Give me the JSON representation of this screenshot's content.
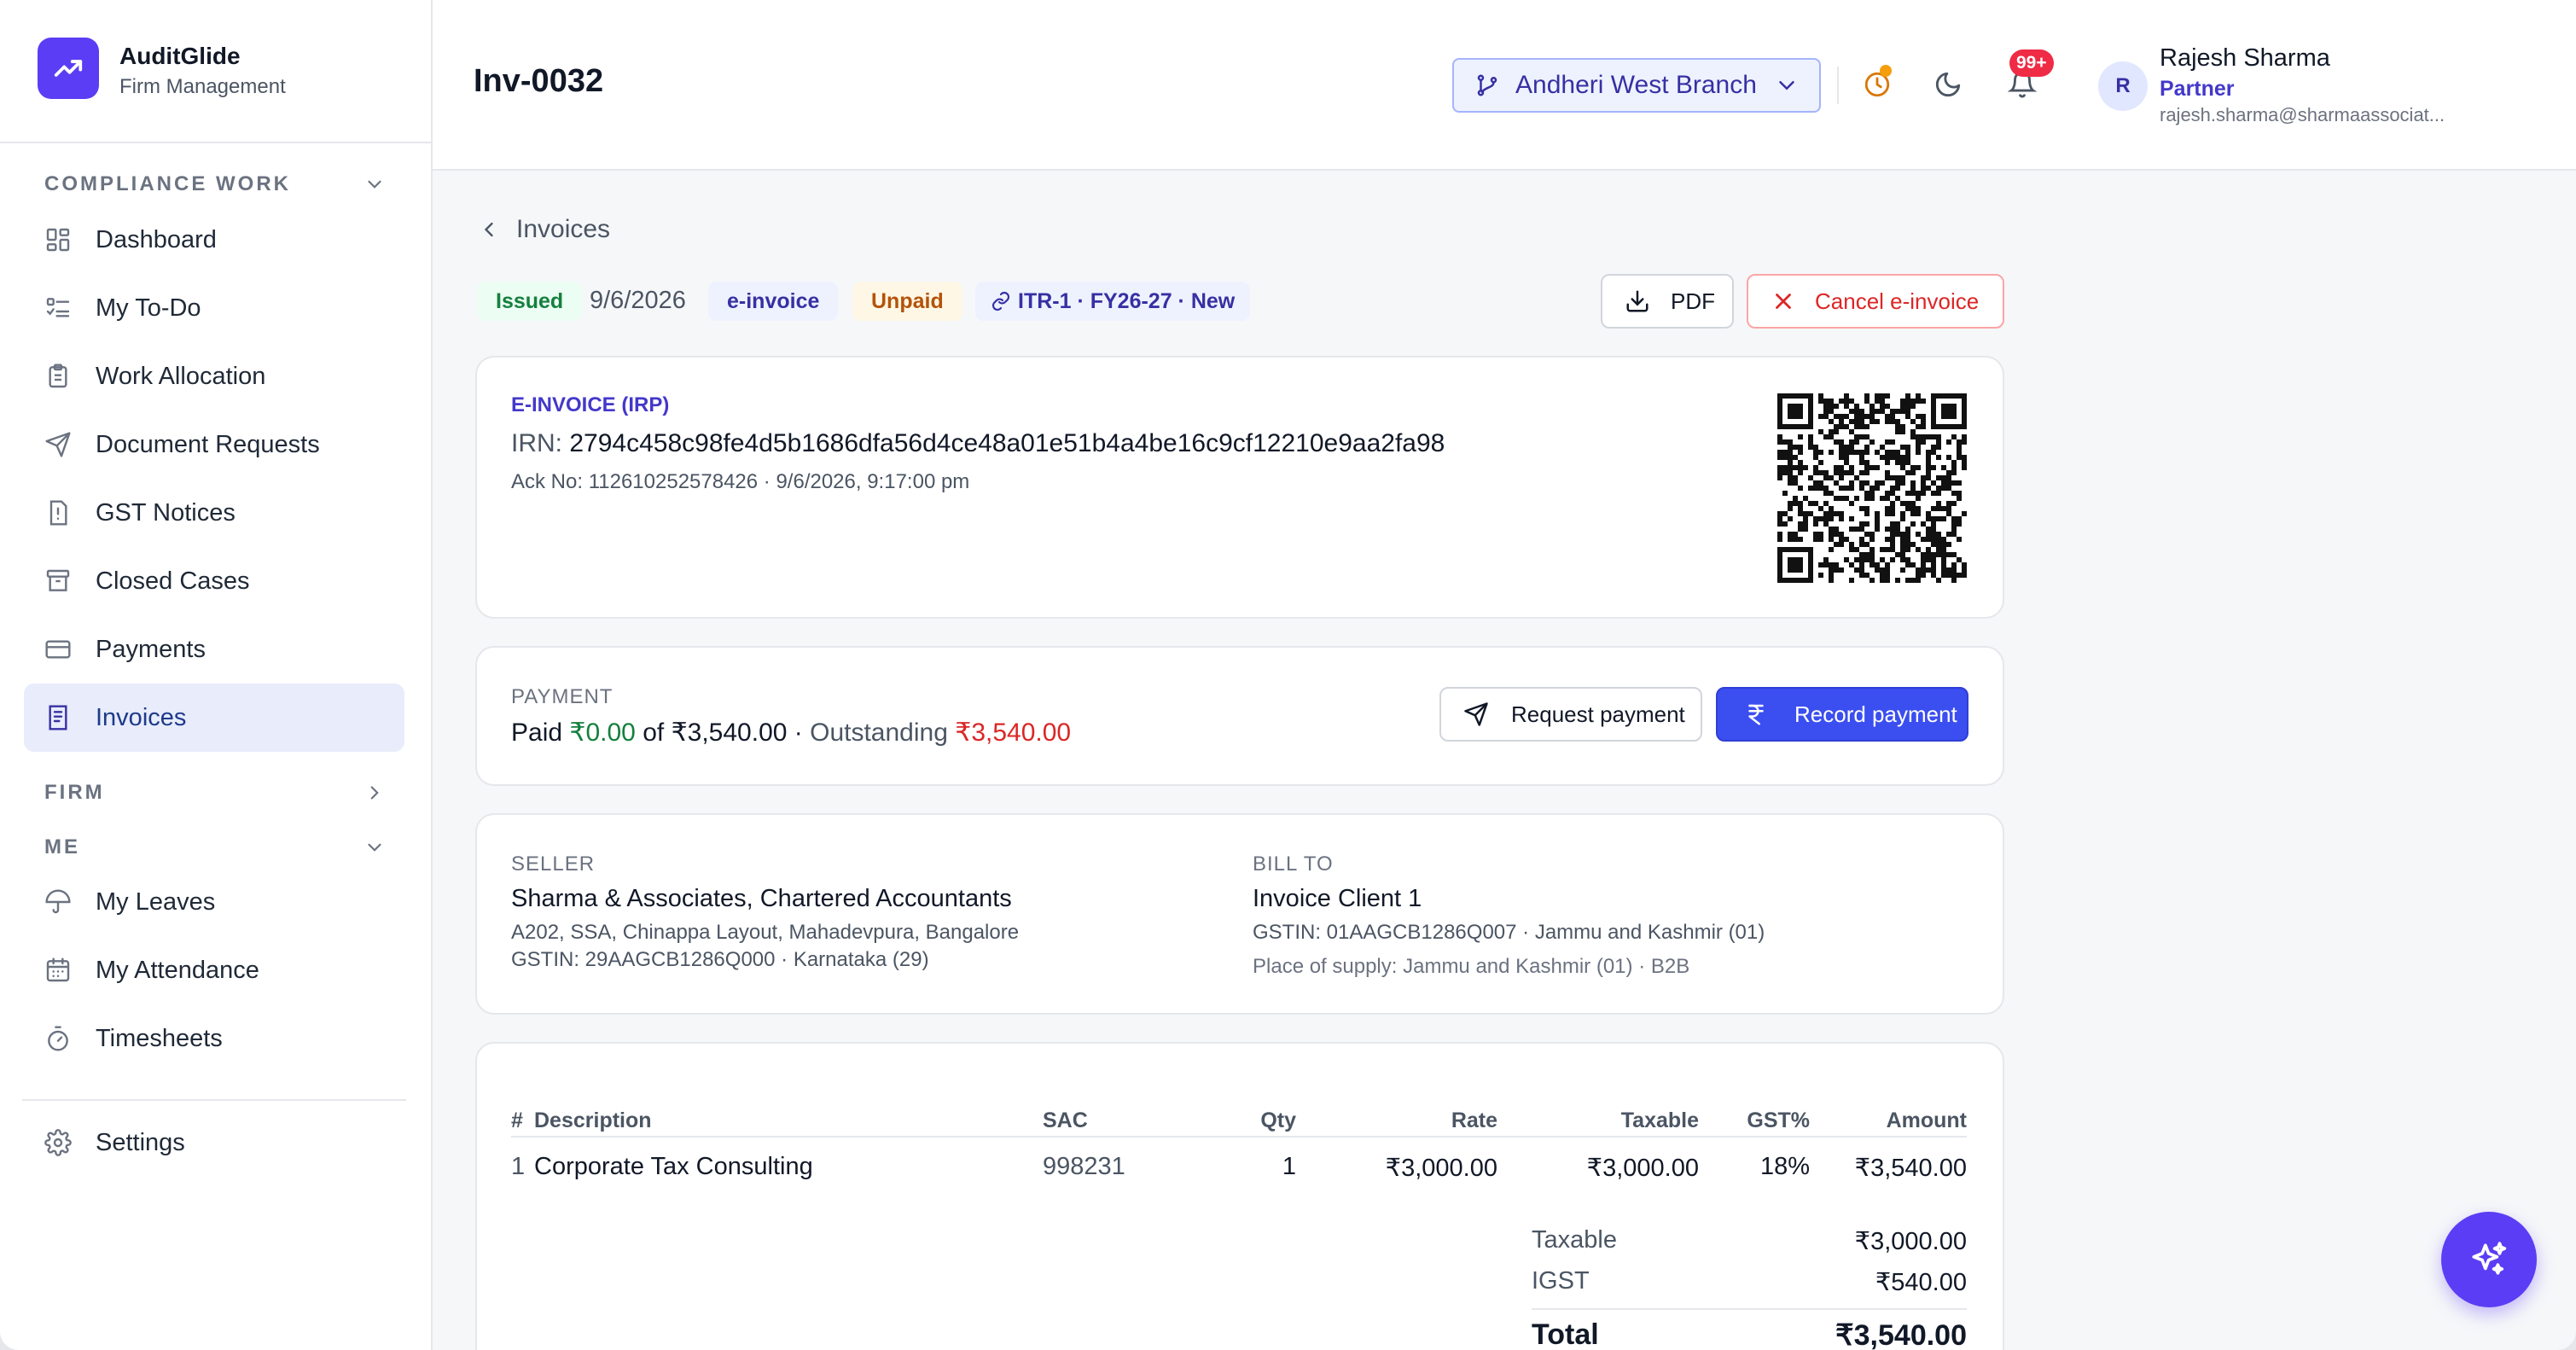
{
  "brand": {
    "name": "AuditGlide",
    "subtitle": "Firm Management"
  },
  "sidebar": {
    "sections": [
      {
        "label": "COMPLIANCE WORK",
        "expanded": true
      },
      {
        "label": "FIRM",
        "expanded": false
      },
      {
        "label": "ME",
        "expanded": true
      }
    ],
    "items": [
      {
        "label": "Dashboard",
        "icon": "dashboard-icon"
      },
      {
        "label": "My To-Do",
        "icon": "todo-list-icon"
      },
      {
        "label": "Work Allocation",
        "icon": "clipboard-icon"
      },
      {
        "label": "Document Requests",
        "icon": "send-icon"
      },
      {
        "label": "GST Notices",
        "icon": "notice-icon"
      },
      {
        "label": "Closed Cases",
        "icon": "archive-icon"
      },
      {
        "label": "Payments",
        "icon": "card-icon"
      },
      {
        "label": "Invoices",
        "icon": "invoice-icon",
        "active": true
      },
      {
        "label": "My Leaves",
        "icon": "umbrella-icon"
      },
      {
        "label": "My Attendance",
        "icon": "calendar-icon"
      },
      {
        "label": "Timesheets",
        "icon": "stopwatch-icon"
      },
      {
        "label": "Settings",
        "icon": "gear-icon"
      }
    ]
  },
  "header": {
    "title": "Inv-0032",
    "branch": "Andheri West Branch",
    "notifications_badge": "99+",
    "user": {
      "initial": "R",
      "name": "Rajesh Sharma",
      "role": "Partner",
      "email": "rajesh.sharma@sharmaassociat..."
    }
  },
  "breadcrumb": "Invoices",
  "status": {
    "issued": "Issued",
    "date": "9/6/2026",
    "type": "e-invoice",
    "payment_state": "Unpaid",
    "linked": "ITR-1 · FY26-27 · New"
  },
  "actions": {
    "pdf": "PDF",
    "cancel": "Cancel e-invoice"
  },
  "einvoice": {
    "label": "E-INVOICE (IRP)",
    "irn_label": "IRN:",
    "irn": "2794c458c98fe4d5b1686dfa56d4ce48a01e51b4a4be16c9cf12210e9aa2fa98",
    "ack": "Ack No: 112610252578426 · 9/6/2026, 9:17:00 pm"
  },
  "payment": {
    "label": "PAYMENT",
    "paid_prefix": "Paid",
    "paid": "₹0.00",
    "of_text": "of ₹3,540.00 ·",
    "outstanding_label": "Outstanding",
    "outstanding": "₹3,540.00",
    "request_label": "Request payment",
    "record_label": "Record payment"
  },
  "seller": {
    "label": "SELLER",
    "name": "Sharma & Associates, Chartered Accountants",
    "address": "A202, SSA, Chinappa Layout, Mahadevpura, Bangalore",
    "gstin": "GSTIN: 29AAGCB1286Q000 · Karnataka (29)"
  },
  "bill_to": {
    "label": "BILL TO",
    "name": "Invoice Client 1",
    "gstin": "GSTIN: 01AAGCB1286Q007 · Jammu and Kashmir (01)",
    "supply": "Place of supply: Jammu and Kashmir (01) · B2B"
  },
  "table": {
    "headers": {
      "num": "#",
      "desc": "Description",
      "sac": "SAC",
      "qty": "Qty",
      "rate": "Rate",
      "taxable": "Taxable",
      "gst": "GST%",
      "amount": "Amount"
    },
    "rows": [
      {
        "num": "1",
        "desc": "Corporate Tax Consulting",
        "sac": "998231",
        "qty": "1",
        "rate": "₹3,000.00",
        "taxable": "₹3,000.00",
        "gst": "18%",
        "amount": "₹3,540.00"
      }
    ]
  },
  "totals": {
    "taxable_label": "Taxable",
    "taxable": "₹3,000.00",
    "igst_label": "IGST",
    "igst": "₹540.00",
    "total_label": "Total",
    "total": "₹3,540.00"
  },
  "colors": {
    "accent": "#5b3df5",
    "primary_button": "#3b4ef0",
    "paid_green": "#15803d",
    "outstanding_red": "#dc2626"
  }
}
